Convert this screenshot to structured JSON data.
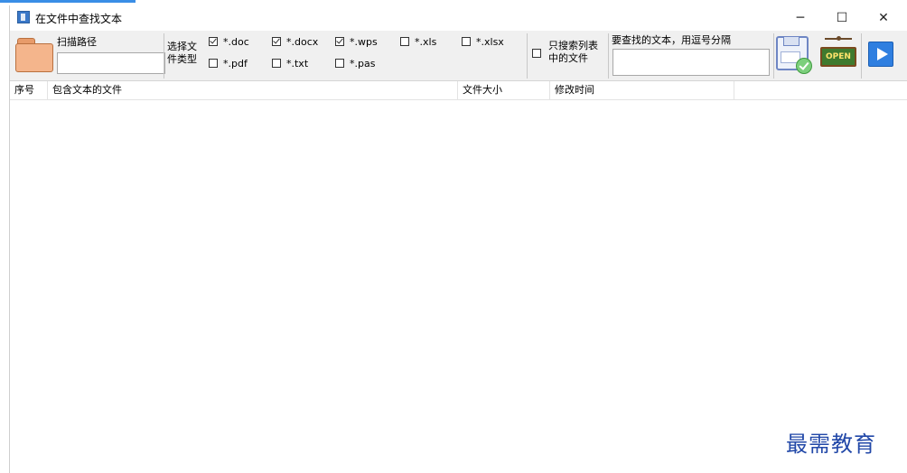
{
  "window": {
    "title": "在文件中查找文本",
    "min_glyph": "─",
    "max_glyph": "☐",
    "close_glyph": "✕"
  },
  "toolbar": {
    "scan_path_label": "扫描路径",
    "scan_path_value": "",
    "file_type_label": "选择文件类型",
    "file_types": [
      {
        "label": "*.doc",
        "checked": true
      },
      {
        "label": "*.docx",
        "checked": true
      },
      {
        "label": "*.wps",
        "checked": true
      },
      {
        "label": "*.xls",
        "checked": false
      },
      {
        "label": "*.xlsx",
        "checked": false
      },
      {
        "label": "*.pdf",
        "checked": false
      },
      {
        "label": "*.txt",
        "checked": false
      },
      {
        "label": "*.pas",
        "checked": false
      }
    ],
    "only_list_label": "只搜索列表中的文件",
    "only_list_checked": false,
    "search_text_label": "要查找的文本，用逗号分隔",
    "search_text_value": "",
    "open_sign_text": "OPEN",
    "icons": [
      "folder-icon",
      "save-icon",
      "open-sign-icon",
      "play-icon"
    ]
  },
  "list": {
    "columns": [
      "序号",
      "包含文本的文件",
      "文件大小",
      "修改时间"
    ]
  },
  "watermark": "最需教育"
}
